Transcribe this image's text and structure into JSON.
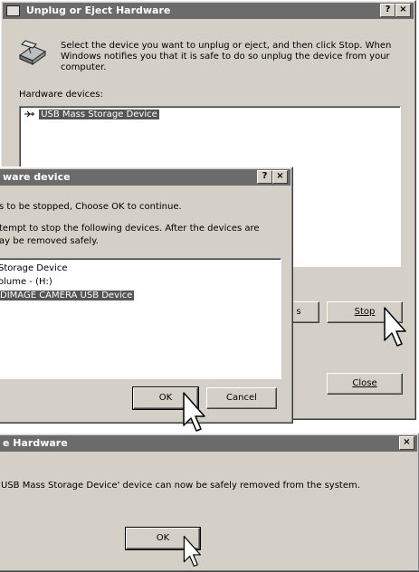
{
  "unplug_window": {
    "title": "Unplug or Eject Hardware",
    "title_buttons": [
      "?",
      "×"
    ],
    "instruction": "Select the device you want to unplug or eject, and then click Stop. When Windows notifies you that it is safe to do so unplug the device from your computer.",
    "list_label": "Hardware devices:",
    "devices": [
      "USB Mass Storage Device"
    ],
    "properties_button_fragment": "s",
    "stop_button": "Stop",
    "close_button": "Close"
  },
  "stop_window": {
    "title": "ware device",
    "title_buttons": [
      "?",
      "×"
    ],
    "message1": "s to be stopped, Choose OK to continue.",
    "message2_line1": "tempt to stop the following devices. After the devices are",
    "message2_line2": "ay be removed safely.",
    "devices": [
      " Storage Device",
      "olume - (H:)",
      " DIMAGE CAMERA USB Device"
    ],
    "ok_button": "OK",
    "cancel_button": "Cancel"
  },
  "safe_window": {
    "title": "e Hardware",
    "title_button": "×",
    "message": "USB Mass Storage Device' device can now be safely removed from the system.",
    "ok_button": "OK"
  },
  "colors": {
    "titlebar": "#6b6b6b",
    "face": "#d4d0c8",
    "selection": "#555555"
  }
}
